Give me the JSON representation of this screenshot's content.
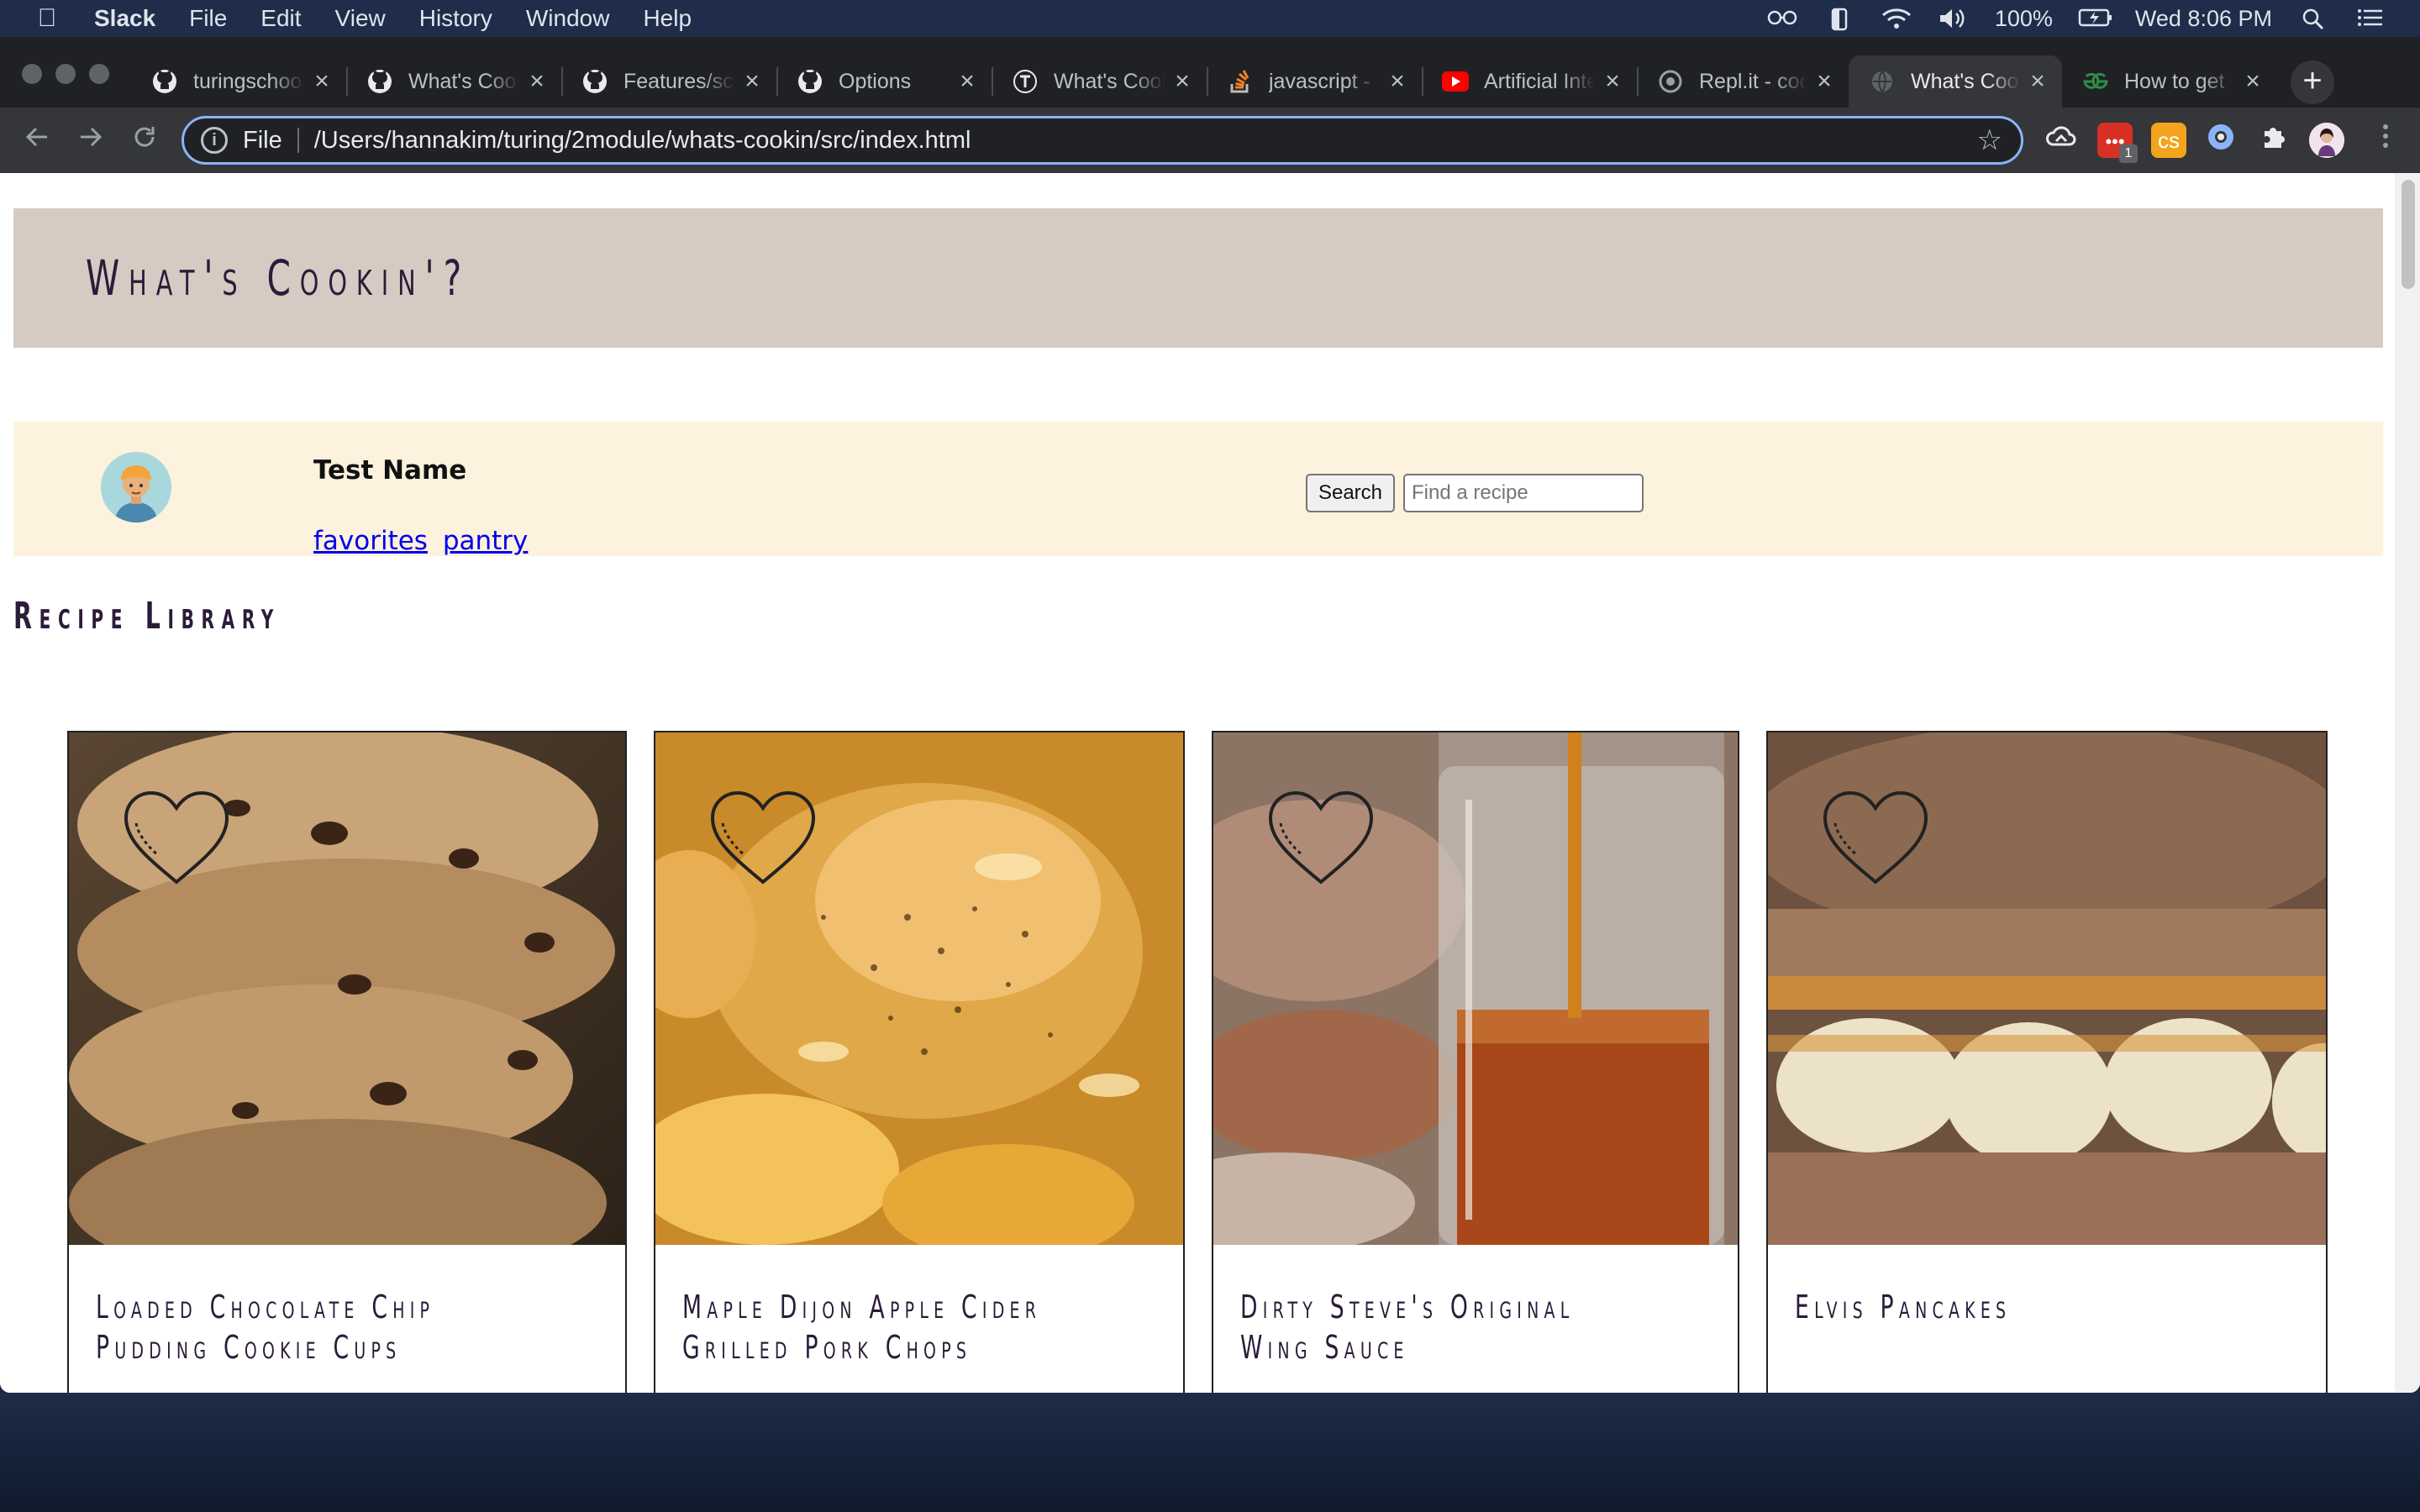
{
  "menubar": {
    "app_name": "Slack",
    "items": [
      "File",
      "Edit",
      "View",
      "History",
      "Window",
      "Help"
    ],
    "battery": "100%",
    "clock": "Wed 8:06 PM"
  },
  "tabs": [
    {
      "title": "turingschool",
      "icon": "github-icon"
    },
    {
      "title": "What's Cookin",
      "icon": "github-icon"
    },
    {
      "title": "Features/scope",
      "icon": "github-icon"
    },
    {
      "title": "Options",
      "icon": "github-icon"
    },
    {
      "title": "What's Cookin",
      "icon": "turing-icon"
    },
    {
      "title": "javascript - ",
      "icon": "stackoverflow-icon"
    },
    {
      "title": "Artificial Intelligence",
      "icon": "youtube-icon"
    },
    {
      "title": "Repl.it - code",
      "icon": "replit-icon"
    },
    {
      "title": "What's Cookin",
      "icon": "globe-icon",
      "active": true
    },
    {
      "title": "How to get",
      "icon": "geeksforgeeks-icon"
    }
  ],
  "toolbar": {
    "scheme": "File",
    "url": "/Users/hannakim/turing/2module/whats-cookin/src/index.html",
    "extension_badge": "1"
  },
  "page": {
    "site_title": "What's Cookin'?",
    "user": {
      "name": "Test Name",
      "links": [
        "favorites",
        "pantry"
      ]
    },
    "search": {
      "button_label": "Search",
      "placeholder": "Find a recipe"
    },
    "section_title": "Recipe Library",
    "recipes": [
      {
        "name": "Loaded Chocolate Chip Pudding Cookie Cups"
      },
      {
        "name": "Maple Dijon Apple Cider Grilled Pork Chops"
      },
      {
        "name": "Dirty Steve's Original Wing Sauce"
      },
      {
        "name": "Elvis Pancakes"
      }
    ]
  }
}
